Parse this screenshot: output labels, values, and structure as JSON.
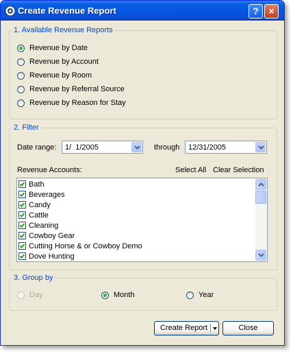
{
  "window": {
    "title": "Create Revenue Report",
    "help_label": "?",
    "close_glyph": "×"
  },
  "reports": {
    "title": "1. Available Revenue Reports",
    "options": [
      {
        "label": "Revenue by Date",
        "selected": true
      },
      {
        "label": "Revenue by Account",
        "selected": false
      },
      {
        "label": "Revenue by Room",
        "selected": false
      },
      {
        "label": "Revenue by Referral Source",
        "selected": false
      },
      {
        "label": "Revenue by Reason for Stay",
        "selected": false
      }
    ]
  },
  "filter": {
    "title": "2. Filter",
    "date_range_label": "Date range:",
    "from_date": "1/  1/2005",
    "through_label": "through",
    "to_date": "12/31/2005",
    "accounts_label": "Revenue Accounts:",
    "select_all_label": "Select All",
    "clear_selection_label": "Clear Selection",
    "accounts": [
      {
        "label": "Bath",
        "checked": true
      },
      {
        "label": "Beverages",
        "checked": true
      },
      {
        "label": "Candy",
        "checked": true
      },
      {
        "label": "Cattle",
        "checked": true
      },
      {
        "label": "Cleaning",
        "checked": true
      },
      {
        "label": "Cowboy Gear",
        "checked": true
      },
      {
        "label": "Cutting Horse & or Cowboy Demo",
        "checked": true
      },
      {
        "label": "Dove Hunting",
        "checked": true
      }
    ]
  },
  "group_by": {
    "title": "3. Group by",
    "options": [
      {
        "label": "Day",
        "selected": false,
        "disabled": true
      },
      {
        "label": "Month",
        "selected": true,
        "disabled": false
      },
      {
        "label": "Year",
        "selected": false,
        "disabled": false
      }
    ]
  },
  "actions": {
    "create_report_label": "Create Report",
    "close_label": "Close"
  },
  "colors": {
    "title_bar": "#0554e3",
    "group_title": "#0046d5",
    "dialog_bg": "#ece9d8",
    "check_mark": "#21a121"
  }
}
